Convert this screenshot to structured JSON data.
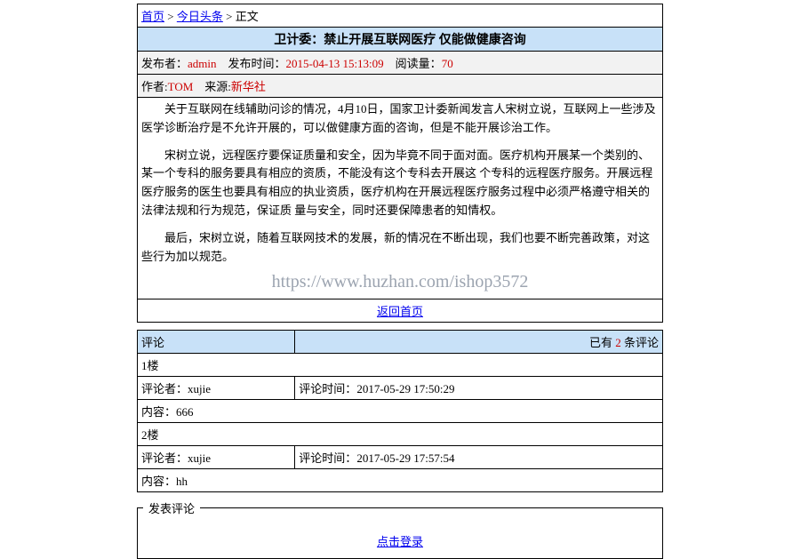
{
  "breadcrumb": {
    "home": "首页",
    "category": "今日头条",
    "sep": " > ",
    "current": "正文"
  },
  "article": {
    "title": "卫计委：禁止开展互联网医疗 仅能做健康咨询",
    "publisher_label": "发布者：",
    "publisher": "admin",
    "publish_time_label": "发布时间：",
    "publish_time": "2015-04-13 15:13:09",
    "read_label": "阅读量：",
    "read_count": "70",
    "author_label": "作者:",
    "author": "TOM",
    "source_label": "来源:",
    "source": "新华社",
    "paragraphs": [
      "关于互联网在线辅助问诊的情况，4月10日，国家卫计委新闻发言人宋树立说，互联网上一些涉及医学诊断治疗是不允许开展的，可以做健康方面的咨询，但是不能开展诊治工作。",
      "宋树立说，远程医疗要保证质量和安全，因为毕竟不同于面对面。医疗机构开展某一个类别的、某一个专科的服务要具有相应的资质，不能没有这个专科去开展这 个专科的远程医疗服务。开展远程医疗服务的医生也要具有相应的执业资质，医疗机构在开展远程医疗服务过程中必须严格遵守相关的法律法规和行为规范，保证质 量与安全，同时还要保障患者的知情权。",
      "最后，宋树立说，随着互联网技术的发展，新的情况在不断出现，我们也要不断完善政策，对这些行为加以规范。"
    ],
    "watermark": "https://www.huzhan.com/ishop3572",
    "back_home": "返回首页"
  },
  "comments": {
    "heading": "评论",
    "count_prefix": "已有 ",
    "count": "2",
    "count_suffix": " 条评论",
    "floor_suffix": "楼",
    "commenter_label": "评论者：",
    "time_label": "评论时间：",
    "content_label": "内容：",
    "items": [
      {
        "floor": "1",
        "user": "xujie",
        "time": "2017-05-29 17:50:29",
        "content": "666"
      },
      {
        "floor": "2",
        "user": "xujie",
        "time": "2017-05-29 17:57:54",
        "content": "hh"
      }
    ]
  },
  "reply": {
    "legend": "发表评论",
    "login": "点击登录"
  }
}
